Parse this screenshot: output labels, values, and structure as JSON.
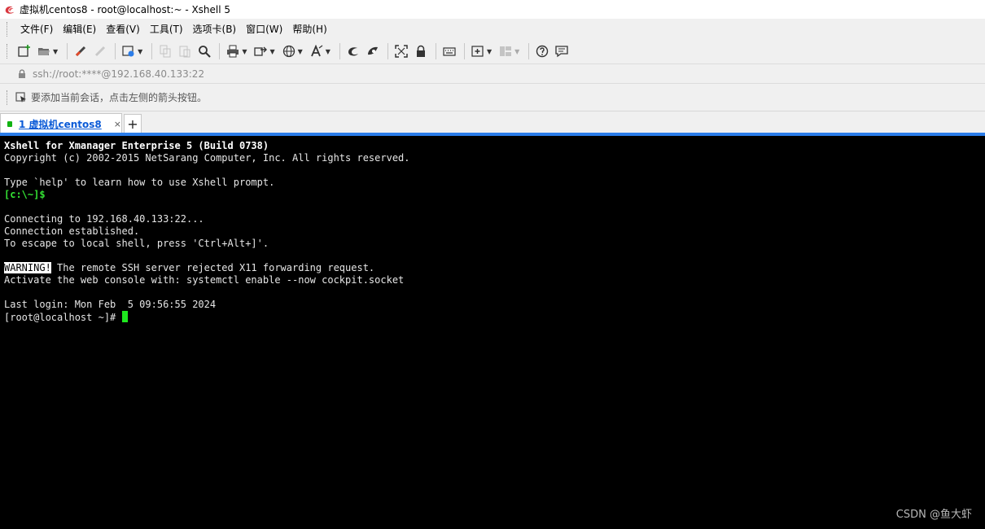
{
  "window": {
    "title": "虚拟机centos8 - root@localhost:~ - Xshell 5"
  },
  "menubar": {
    "items": [
      "文件(F)",
      "编辑(E)",
      "查看(V)",
      "工具(T)",
      "选项卡(B)",
      "窗口(W)",
      "帮助(H)"
    ]
  },
  "toolbar": {
    "icons": [
      "new-session-icon",
      "open-folder-icon",
      "connect-icon",
      "disconnect-icon",
      "properties-icon",
      "copy-icon",
      "paste-icon",
      "find-icon",
      "print-icon",
      "transfer-icon",
      "globe-icon",
      "font-icon",
      "xftp-icon",
      "xmanager-icon",
      "fullscreen-icon",
      "lock-icon",
      "keyboard-icon",
      "add-tab-icon",
      "layout-icon",
      "help-icon",
      "chat-icon"
    ]
  },
  "address": {
    "value": "ssh://root:****@192.168.40.133:22"
  },
  "hint": {
    "text": "要添加当前会话，点击左侧的箭头按钮。"
  },
  "tabs": {
    "active_label": "1 虚拟机centos8",
    "close_glyph": "×",
    "add_glyph": "+"
  },
  "terminal": {
    "lines": {
      "l1": "Xshell for Xmanager Enterprise 5 (Build 0738)",
      "l2": "Copyright (c) 2002-2015 NetSarang Computer, Inc. All rights reserved.",
      "l3": "Type `help' to learn how to use Xshell prompt.",
      "l4": "[c:\\~]$",
      "l5": "Connecting to 192.168.40.133:22...",
      "l6": "Connection established.",
      "l7": "To escape to local shell, press 'Ctrl+Alt+]'.",
      "l8_warn": "WARNING!",
      "l8_rest": " The remote SSH server rejected X11 forwarding request.",
      "l9": "Activate the web console with: systemctl enable --now cockpit.socket",
      "l10": "Last login: Mon Feb  5 09:56:55 2024",
      "l11": "[root@localhost ~]# "
    }
  },
  "watermark": {
    "text": "CSDN @鱼大虾"
  }
}
